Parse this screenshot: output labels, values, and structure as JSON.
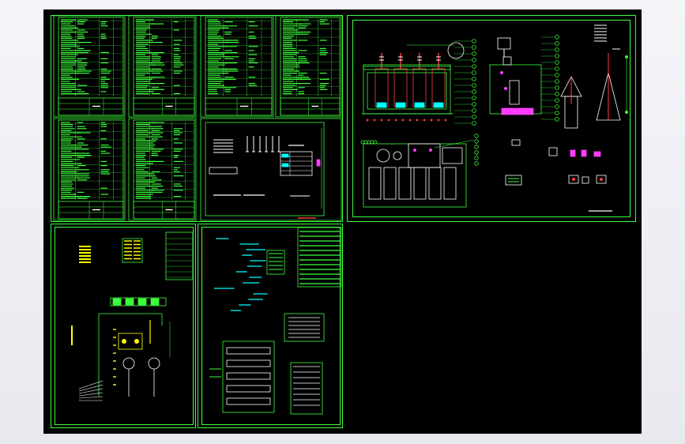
{
  "viewer": {
    "background": "#000000",
    "line_color": "#3cff3c",
    "accent_colors": [
      "#ffff00",
      "#ff3cff",
      "#00ffff",
      "#ff3c3c",
      "#ffffff"
    ]
  },
  "sheets": [
    {
      "id": "table-sheet-1",
      "kind": "parameter-table"
    },
    {
      "id": "table-sheet-2",
      "kind": "parameter-table"
    },
    {
      "id": "table-sheet-3",
      "kind": "parameter-table"
    },
    {
      "id": "table-sheet-4",
      "kind": "parameter-table"
    },
    {
      "id": "table-sheet-5",
      "kind": "parameter-table"
    },
    {
      "id": "table-sheet-6",
      "kind": "parameter-table"
    },
    {
      "id": "nameplate-sheet",
      "kind": "nameplate-drawing"
    },
    {
      "id": "transformer-assembly-sheet",
      "kind": "general-assembly-drawing"
    },
    {
      "id": "wiring-schematic-sheet",
      "kind": "electrical-schematic"
    },
    {
      "id": "control-circuit-sheet",
      "kind": "control-circuit-drawing"
    }
  ]
}
